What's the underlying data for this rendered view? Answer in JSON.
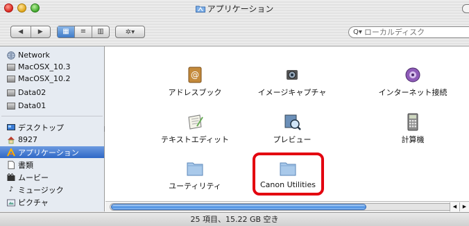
{
  "window": {
    "title": "アプリケーション"
  },
  "search": {
    "placeholder": "ローカルディスク"
  },
  "toolbar": {
    "back": "◀",
    "forward": "▶",
    "view_icon": "▦",
    "view_list": "≡",
    "view_column": "▥",
    "action": "✲▾"
  },
  "sidebar": {
    "items": [
      {
        "label": "Network",
        "icon": "network-icon"
      },
      {
        "label": "MacOSX_10.3",
        "icon": "hard-disk-icon"
      },
      {
        "label": "MacOSX_10.2",
        "icon": "hard-disk-icon"
      },
      {
        "label": "Data02",
        "icon": "hard-disk-icon"
      },
      {
        "label": "Data01",
        "icon": "hard-disk-icon"
      },
      {
        "label": "デスクトップ",
        "icon": "desktop-icon"
      },
      {
        "label": "8927",
        "icon": "home-icon"
      },
      {
        "label": "アプリケーション",
        "icon": "applications-icon",
        "selected": true
      },
      {
        "label": "書類",
        "icon": "documents-icon"
      },
      {
        "label": "ムービー",
        "icon": "movies-icon"
      },
      {
        "label": "ミュージック",
        "icon": "music-icon"
      },
      {
        "label": "ピクチャ",
        "icon": "pictures-icon"
      }
    ]
  },
  "content": {
    "apps": [
      {
        "label": "アドレスブック",
        "icon": "address-book-icon"
      },
      {
        "label": "イメージキャプチャ",
        "icon": "image-capture-icon"
      },
      {
        "label": "インターネット接続",
        "icon": "internet-connect-icon"
      },
      {
        "label": "テキストエディット",
        "icon": "textedit-icon"
      },
      {
        "label": "プレビュー",
        "icon": "preview-icon"
      },
      {
        "label": "計算機",
        "icon": "calculator-icon"
      },
      {
        "label": "ユーティリティ",
        "icon": "folder-icon"
      },
      {
        "label": "Canon Utilities",
        "icon": "folder-icon",
        "highlighted": true
      }
    ]
  },
  "status": {
    "text": "25 項目、15.22 GB 空き"
  },
  "colors": {
    "highlight_border": "#e3000f",
    "selection": "#3f74cc",
    "sidebar_bg": "#e6ebf2"
  }
}
